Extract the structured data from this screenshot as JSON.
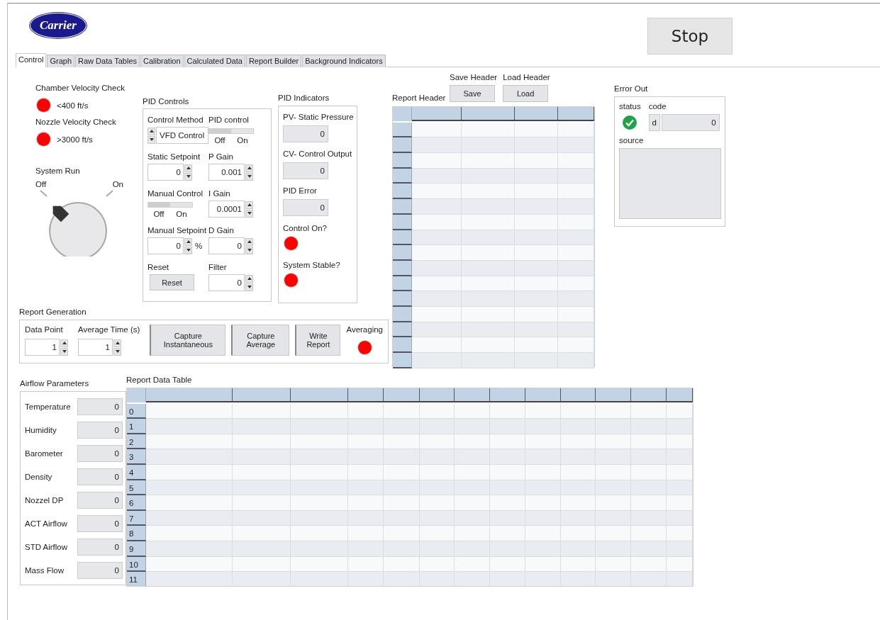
{
  "logo": {
    "text": "Carrier"
  },
  "stop_button": {
    "label": "Stop"
  },
  "tabs": [
    {
      "label": "Control",
      "selected": true
    },
    {
      "label": "Graph",
      "selected": false
    },
    {
      "label": "Raw Data Tables",
      "selected": false
    },
    {
      "label": "Calibration",
      "selected": false
    },
    {
      "label": "Calculated Data",
      "selected": false
    },
    {
      "label": "Report Builder",
      "selected": false
    },
    {
      "label": "Background Indicators",
      "selected": false
    }
  ],
  "velocity_checks": [
    {
      "label": "Chamber Velocity Check",
      "caption": "<400 ft/s",
      "on": true
    },
    {
      "label": "Nozzle Velocity Check",
      "caption": ">3000 ft/s",
      "on": true
    }
  ],
  "system_run": {
    "label": "System Run",
    "off_label": "Off",
    "on_label": "On",
    "on": false
  },
  "pid_controls": {
    "title": "PID Controls",
    "items": [
      {
        "kind": "ring",
        "label": "Control Method",
        "value": "VFD Control"
      },
      {
        "kind": "switch",
        "label": "PID control",
        "off_label": "Off",
        "on_label": "On",
        "on": false
      },
      {
        "kind": "numeric",
        "label": "Static Setpoint",
        "value": "0"
      },
      {
        "kind": "numeric",
        "label": "P Gain",
        "value": "0.001"
      },
      {
        "kind": "switch",
        "label": "Manual Control",
        "off_label": "Off",
        "on_label": "On",
        "on": false
      },
      {
        "kind": "numeric",
        "label": "I Gain",
        "value": "0.0001"
      },
      {
        "kind": "numeric",
        "label": "Manual Setpoint",
        "value": "0",
        "unit": "%"
      },
      {
        "kind": "numeric",
        "label": "D Gain",
        "value": "0"
      },
      {
        "kind": "button",
        "label": "Reset",
        "button_label": "Reset"
      },
      {
        "kind": "numeric",
        "label": "Filter",
        "value": "0"
      }
    ]
  },
  "pid_indicators": {
    "title": "PID Indicators",
    "items": [
      {
        "kind": "value",
        "label": "PV- Static Pressure",
        "value": "0"
      },
      {
        "kind": "value",
        "label": "CV- Control Output",
        "value": "0"
      },
      {
        "kind": "value",
        "label": "PID Error",
        "value": "0"
      },
      {
        "kind": "led",
        "label": "Control On?",
        "on": true
      },
      {
        "kind": "led",
        "label": "System Stable?",
        "on": true
      }
    ]
  },
  "report_header": {
    "title": "Report Header",
    "buttons": [
      {
        "label": "Save Header",
        "button_label": "Save"
      },
      {
        "label": "Load Header",
        "button_label": "Load"
      }
    ]
  },
  "error_out": {
    "title": "Error Out",
    "status": {
      "label": "status",
      "ok": true
    },
    "code": {
      "label": "code",
      "format": "d",
      "value": "0"
    },
    "source": {
      "label": "source"
    }
  },
  "report_generation": {
    "title": "Report Generation",
    "inputs": [
      {
        "label": "Data Point",
        "value": "1"
      },
      {
        "label": "Average Time (s)",
        "value": "1"
      }
    ],
    "buttons": [
      "Capture Instantaneous",
      "Capture Average",
      "Write Report"
    ],
    "averaging": {
      "label": "Averaging",
      "on": true
    }
  },
  "airflow_parameters": {
    "title": "Airflow Parameters",
    "items": [
      {
        "label": "Temperature",
        "value": "0"
      },
      {
        "label": "Humidity",
        "value": "0"
      },
      {
        "label": "Barometer",
        "value": "0"
      },
      {
        "label": "Density",
        "value": "0"
      },
      {
        "label": "Nozzel DP",
        "value": "0"
      },
      {
        "label": "ACT Airflow",
        "value": "0"
      },
      {
        "label": "STD Airflow",
        "value": "0"
      },
      {
        "label": "Mass Flow",
        "value": "0"
      }
    ]
  },
  "report_data_table": {
    "title": "Report Data Table",
    "row_headers": [
      "0",
      "1",
      "2",
      "3",
      "4",
      "5",
      "6",
      "7",
      "8",
      "9",
      "10",
      "11"
    ]
  }
}
